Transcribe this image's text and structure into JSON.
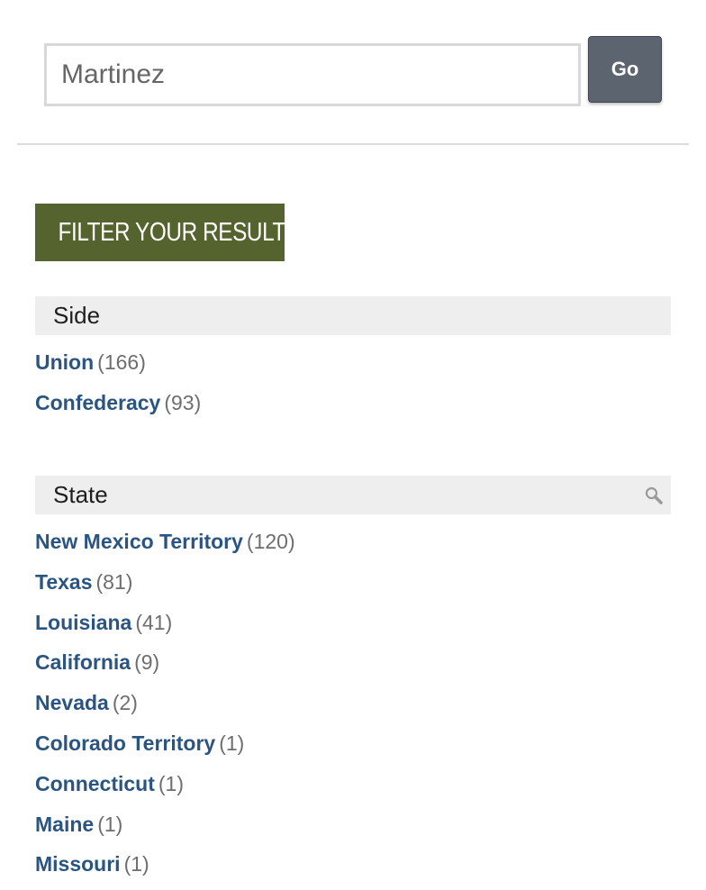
{
  "search": {
    "value": "Martinez",
    "button_label": "Go"
  },
  "filter_heading": "FILTER YOUR RESULTS",
  "facets": {
    "side": {
      "title": "Side",
      "items": [
        {
          "label": "Union",
          "count": "(166)"
        },
        {
          "label": "Confederacy",
          "count": "(93)"
        }
      ]
    },
    "state": {
      "title": "State",
      "search_icon": "magnifier-icon",
      "items": [
        {
          "label": "New Mexico Territory",
          "count": "(120)"
        },
        {
          "label": "Texas",
          "count": "(81)"
        },
        {
          "label": "Louisiana",
          "count": "(41)"
        },
        {
          "label": "California",
          "count": "(9)"
        },
        {
          "label": "Nevada",
          "count": "(2)"
        },
        {
          "label": "Colorado Territory",
          "count": "(1)"
        },
        {
          "label": "Connecticut",
          "count": "(1)"
        },
        {
          "label": "Maine",
          "count": "(1)"
        },
        {
          "label": "Missouri",
          "count": "(1)"
        }
      ]
    }
  },
  "colors": {
    "filter_heading_bg": "#55632e",
    "link": "#2a5582",
    "go_button_bg": "#5c6470"
  }
}
